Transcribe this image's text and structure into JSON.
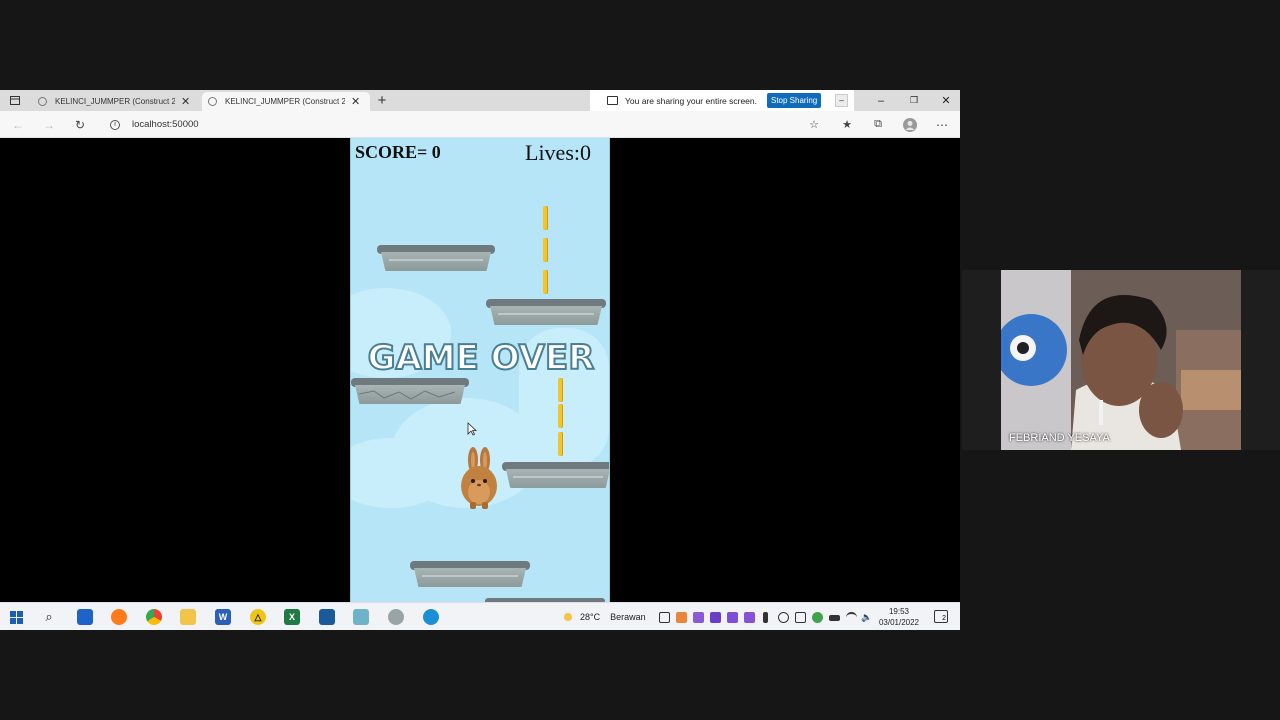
{
  "browser": {
    "tabs": [
      {
        "title": "KELINCI_JUMMPER (Construct 2"
      },
      {
        "title": "KELINCI_JUMMPER (Construct 2"
      }
    ],
    "new_tab": "+",
    "url": "localhost:50000",
    "sharing": {
      "message": "You are sharing your entire screen.",
      "stop_label": "Stop Sharing"
    },
    "window_controls": {
      "minimize": "–",
      "restore": "❐",
      "close": "✕"
    }
  },
  "game": {
    "score_text": "SCORE= 0",
    "lives_text": "Lives:0",
    "gameover_text": "GAME OVER"
  },
  "taskbar": {
    "weather_temp": "28°C",
    "weather_desc": "Berawan",
    "time": "19:53",
    "date": "03/01/2022",
    "notification_count": "2"
  },
  "webcam": {
    "participant_name": "FEBRIAND YESAYA"
  },
  "colors": {
    "sky": "#b7e5f8",
    "coin": "#f4c526",
    "stop_sharing": "#0f6cbd",
    "gameover_outline": "#4a7f92"
  }
}
